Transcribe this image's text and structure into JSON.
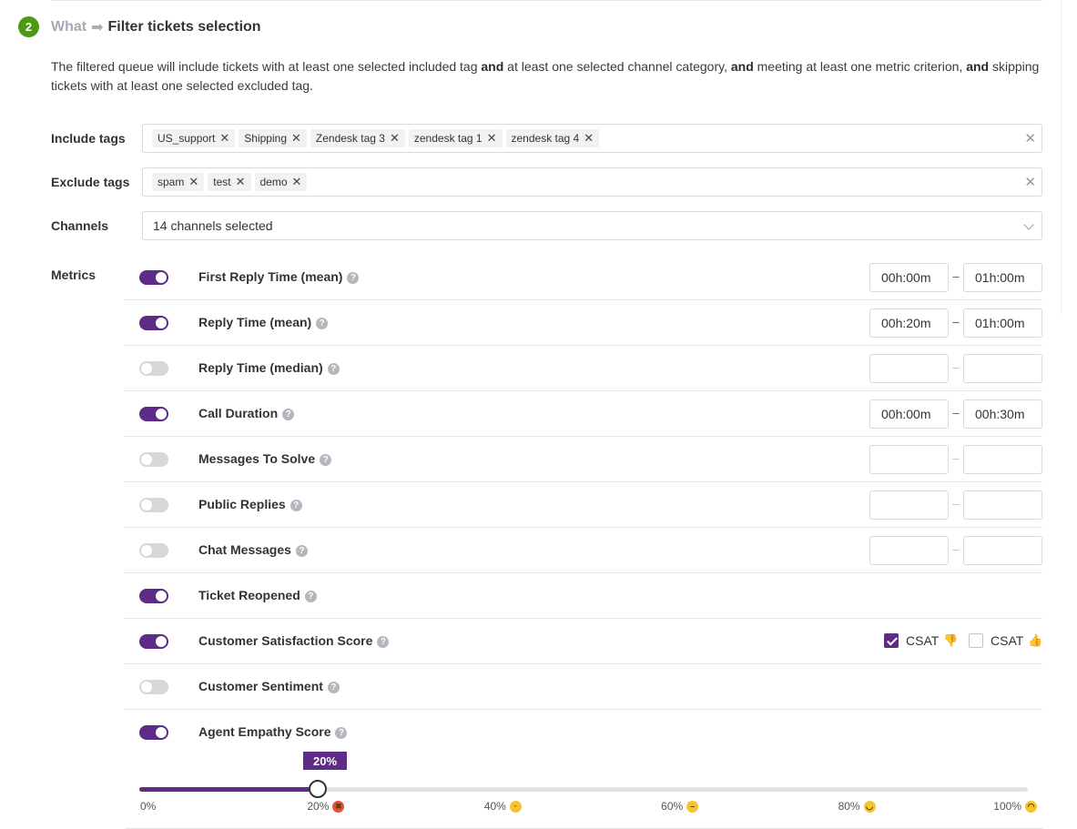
{
  "step": {
    "number": "2",
    "what": "What",
    "arrow": "➡",
    "title": "Filter tickets selection"
  },
  "description": {
    "p1": "The filtered queue will include tickets with at least one selected included tag ",
    "b1": "and",
    "p2": " at least one selected channel category, ",
    "b2": "and",
    "p3": " meeting at least one metric criterion, ",
    "b3": "and",
    "p4": " skipping tickets with at least one selected excluded tag."
  },
  "include_tags": {
    "label": "Include tags",
    "tags": [
      "US_support",
      "Shipping",
      "Zendesk tag 3",
      "zendesk tag 1",
      "zendesk tag 4"
    ]
  },
  "exclude_tags": {
    "label": "Exclude tags",
    "tags": [
      "spam",
      "test",
      "demo"
    ]
  },
  "channels": {
    "label": "Channels",
    "value": "14 channels selected"
  },
  "metrics": {
    "label": "Metrics",
    "help_glyph": "?",
    "dash": "–",
    "items": [
      {
        "label": "First Reply Time (mean)",
        "enabled": true,
        "from": "00h:00m",
        "to": "01h:00m"
      },
      {
        "label": "Reply Time (mean)",
        "enabled": true,
        "from": "00h:20m",
        "to": "01h:00m"
      },
      {
        "label": "Reply Time (median)",
        "enabled": false,
        "from": "",
        "to": ""
      },
      {
        "label": "Call Duration",
        "enabled": true,
        "from": "00h:00m",
        "to": "00h:30m"
      },
      {
        "label": "Messages To Solve",
        "enabled": false,
        "from": "",
        "to": ""
      },
      {
        "label": "Public Replies",
        "enabled": false,
        "from": "",
        "to": ""
      },
      {
        "label": "Chat Messages",
        "enabled": false,
        "from": "",
        "to": ""
      },
      {
        "label": "Ticket Reopened",
        "enabled": true
      },
      {
        "label": "Customer Satisfaction Score",
        "enabled": true
      },
      {
        "label": "Customer Sentiment",
        "enabled": false
      },
      {
        "label": "Agent Empathy Score",
        "enabled": true
      }
    ]
  },
  "csat": {
    "negative": {
      "label": "CSAT",
      "checked": true,
      "icon": "👎"
    },
    "positive": {
      "label": "CSAT",
      "checked": false,
      "icon": "👍"
    }
  },
  "empathy_slider": {
    "value": 20,
    "value_label": "20%",
    "ticks": [
      {
        "label": "0%",
        "face": "",
        "face_color": ""
      },
      {
        "label": "20%",
        "face": "angry-face-icon",
        "face_color": "#e0533a"
      },
      {
        "label": "40%",
        "face": "frown-face-icon",
        "face_color": "#f5c431"
      },
      {
        "label": "60%",
        "face": "neutral-face-icon",
        "face_color": "#f5c431"
      },
      {
        "label": "80%",
        "face": "smile-face-icon",
        "face_color": "#f5c431"
      },
      {
        "label": "100%",
        "face": "grin-face-icon",
        "face_color": "#f5c431"
      }
    ]
  },
  "colors": {
    "accent": "#5e2b86",
    "step_badge": "#4a9a14"
  }
}
